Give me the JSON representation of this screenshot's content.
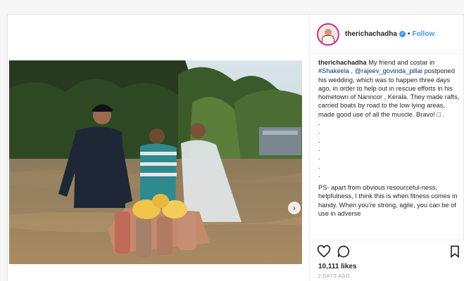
{
  "header": {
    "username": "therichachadha",
    "separator": "•",
    "follow_label": "Follow",
    "verified_icon": "verified-badge-icon"
  },
  "caption": {
    "username": "therichachadha",
    "line_1_text": " My friend and costar in",
    "hashtag": "#Shakeela",
    "mention_sep": " , ",
    "mention": "@rajeev_govinda_pillai",
    "body": "postponed his wedding, which was to happen three days ago, in order to help out in rescue efforts in his hometown of Nanncor , Kerala. They made rafts, carried boats by road to the low lying areas, made good use of all the muscle. Bravo! □ .",
    "dots": [
      ".",
      ".",
      ".",
      ".",
      ".",
      ".",
      "."
    ],
    "ps": "PS- apart from obvious resourceful-ness, helpfulness, I think this is when fitness comes in handy. When you're strong, agile, you can be of use in adverse"
  },
  "actions": {
    "like_icon": "heart-icon",
    "comment_icon": "comment-icon",
    "save_icon": "bookmark-icon",
    "likes": "10,111 likes",
    "time_ago": "2 DAYS AGO"
  },
  "media": {
    "next_icon": "chevron-right-icon",
    "next_glyph": "›"
  },
  "colors": {
    "accent_blue": "#3897f0",
    "link_blue": "#003569",
    "text": "#262626"
  }
}
